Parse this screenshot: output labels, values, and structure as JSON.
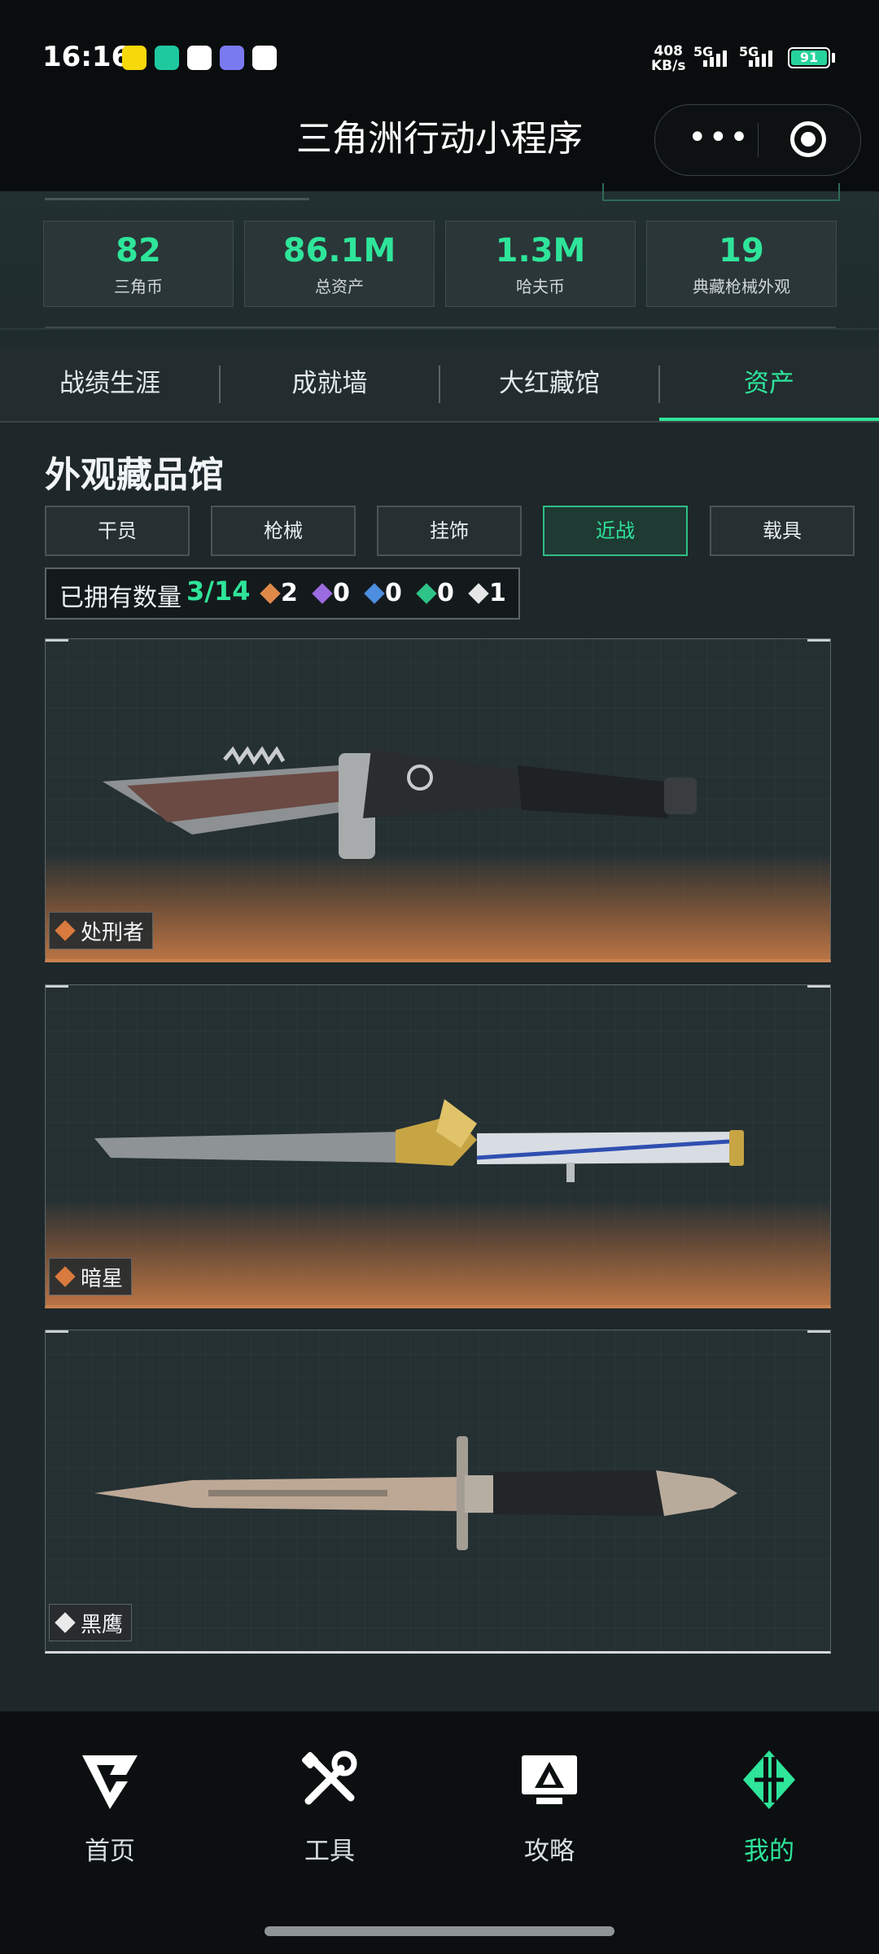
{
  "status_bar": {
    "time": "16:16",
    "net_speed": "408",
    "net_unit": "KB/s",
    "signal_1": "5G",
    "signal_2": "5G",
    "battery": "91",
    "app_icons": [
      "app-1-icon",
      "app-2-icon",
      "taobao-icon",
      "app-4-icon",
      "app-5-icon"
    ]
  },
  "title_bar": {
    "title": "三角洲行动小程序",
    "more_icon": "more-dots-icon",
    "close_icon": "target-circle-icon"
  },
  "stats": [
    {
      "value": "82",
      "label": "三角币"
    },
    {
      "value": "86.1M",
      "label": "总资产"
    },
    {
      "value": "1.3M",
      "label": "哈夫币"
    },
    {
      "value": "19",
      "label": "典藏枪械外观"
    }
  ],
  "tabs": [
    {
      "label": "战绩生涯",
      "active": false
    },
    {
      "label": "成就墙",
      "active": false
    },
    {
      "label": "大红藏馆",
      "active": false
    },
    {
      "label": "资产",
      "active": true
    }
  ],
  "section": {
    "title": "外观藏品馆",
    "categories": [
      {
        "label": "干员",
        "active": false
      },
      {
        "label": "枪械",
        "active": false
      },
      {
        "label": "挂饰",
        "active": false
      },
      {
        "label": "近战",
        "active": true
      },
      {
        "label": "载具",
        "active": false
      }
    ],
    "owned": {
      "label": "已拥有数量",
      "count": "3/14",
      "rarity_counts": [
        {
          "icon": "orange-rarity-icon",
          "color": "#e08a4a",
          "count": "2"
        },
        {
          "icon": "purple-rarity-icon",
          "color": "#9b6be0",
          "count": "0"
        },
        {
          "icon": "blue-rarity-icon",
          "color": "#4d8ee0",
          "count": "0"
        },
        {
          "icon": "green-rarity-icon",
          "color": "#2ec487",
          "count": "0"
        },
        {
          "icon": "white-rarity-icon",
          "color": "#e6e6e6",
          "count": "1"
        }
      ]
    }
  },
  "items": [
    {
      "name": "处刑者",
      "rarity": "orange",
      "image": "combat-knife-image"
    },
    {
      "name": "暗星",
      "rarity": "orange",
      "image": "gold-eagle-knife-image"
    },
    {
      "name": "黑鹰",
      "rarity": "white",
      "image": "bayonet-knife-image"
    }
  ],
  "bottom_nav": [
    {
      "label": "首页",
      "icon": "home-g-logo-icon",
      "active": false
    },
    {
      "label": "工具",
      "icon": "tools-icon",
      "active": false
    },
    {
      "label": "攻略",
      "icon": "guide-monitor-icon",
      "active": false
    },
    {
      "label": "我的",
      "icon": "profile-logo-icon",
      "active": true
    }
  ],
  "colors": {
    "accent": "#2ee59a",
    "orange_rarity": "#c98250",
    "background": "#1e272a"
  }
}
